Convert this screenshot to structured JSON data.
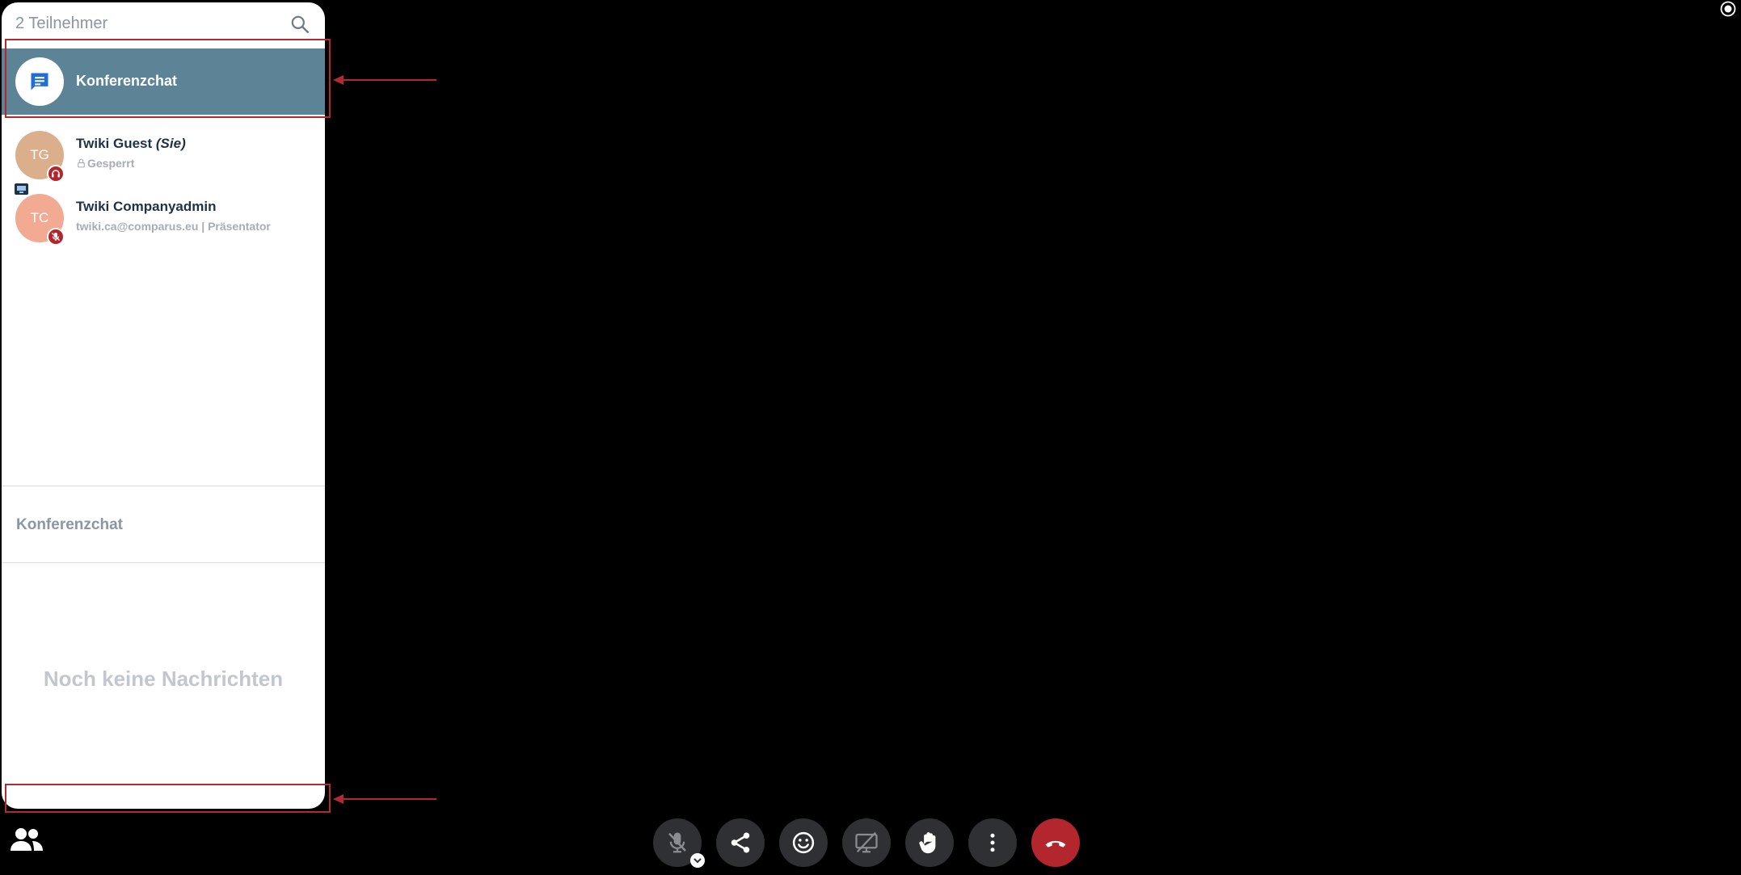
{
  "sidebar": {
    "participants_count": "2 Teilnehmer",
    "conference_chat_item": {
      "label": "Konferenzchat"
    },
    "participants": [
      {
        "initials": "TG",
        "name": "Twiki Guest",
        "you_label": "(Sie)",
        "status": "Gesperrt",
        "avatar_color": "#dbae8c"
      },
      {
        "initials": "TC",
        "name": "Twiki Companyadmin",
        "status": "twiki.ca@comparus.eu | Präsentator",
        "avatar_color": "#f2aa92"
      }
    ],
    "chat_heading": "Konferenzchat",
    "empty_chat_text": "Noch keine Nachrichten"
  },
  "toolbar": {
    "buttons": [
      {
        "name": "microphone-muted",
        "icon": "mic-off-icon"
      },
      {
        "name": "share",
        "icon": "share-icon"
      },
      {
        "name": "reactions",
        "icon": "smiley-icon"
      },
      {
        "name": "screen-share-off",
        "icon": "screen-share-off-icon"
      },
      {
        "name": "raise-hand",
        "icon": "hand-icon"
      },
      {
        "name": "more",
        "icon": "more-vertical-icon"
      },
      {
        "name": "hang-up",
        "icon": "phone-hangup-icon"
      }
    ]
  },
  "colors": {
    "panel_background": "#ffffff",
    "selected_row": "#5d8496",
    "annotation_red": "#b02a30",
    "hangup_red": "#b3262e",
    "toolbar_button": "#2f3033",
    "chat_icon_blue": "#1f6fd6"
  }
}
